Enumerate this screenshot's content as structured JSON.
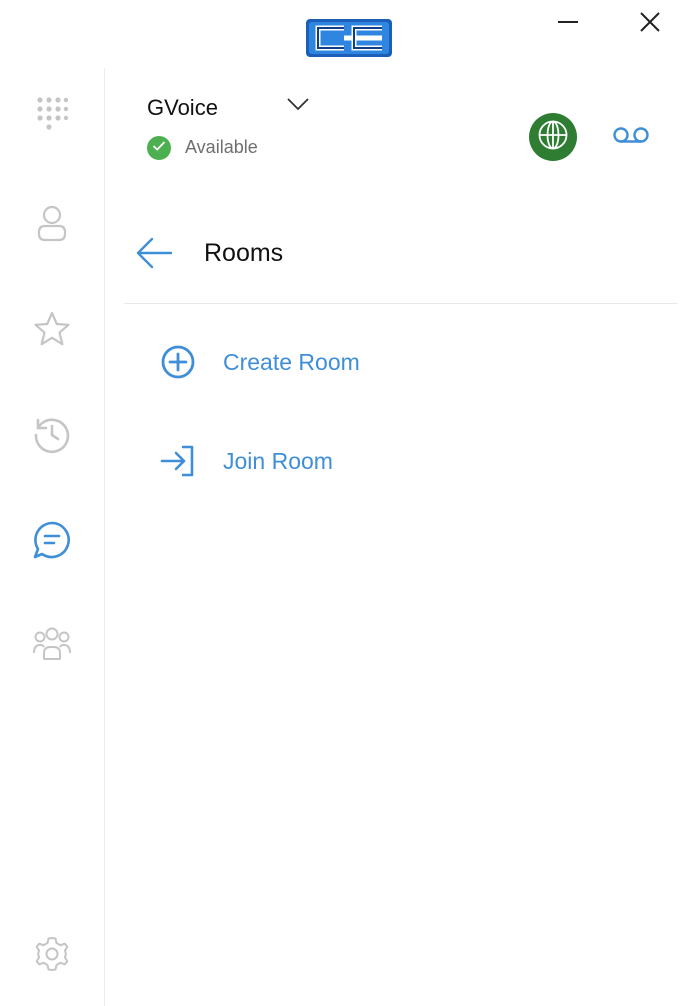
{
  "app": {
    "logo_icon": "cc-logo-icon",
    "window_buttons": {
      "minimize_icon": "minimize-icon",
      "close_icon": "close-icon"
    }
  },
  "sidebar": {
    "items": [
      {
        "icon": "dialpad-icon",
        "active": false
      },
      {
        "icon": "contact-icon",
        "active": false
      },
      {
        "icon": "star-icon",
        "active": false
      },
      {
        "icon": "history-icon",
        "active": false
      },
      {
        "icon": "chat-icon",
        "active": true
      },
      {
        "icon": "group-icon",
        "active": false
      },
      {
        "icon": "gear-icon",
        "active": false
      }
    ]
  },
  "header": {
    "account_name": "GVoice",
    "status": "Available",
    "status_color": "#4caf50",
    "globe_color": "#2e7d32",
    "accent_color": "#3f8fd8"
  },
  "page": {
    "title": "Rooms"
  },
  "menu": {
    "create_room": "Create Room",
    "join_room": "Join Room"
  }
}
